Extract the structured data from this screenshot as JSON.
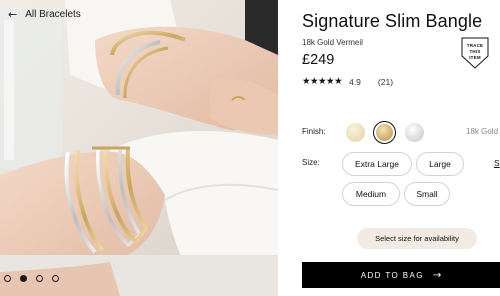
{
  "nav": {
    "back_label": "All Bracelets",
    "back_icon": "arrow-left-icon"
  },
  "gallery": {
    "slides": 4,
    "active_index": 1
  },
  "product": {
    "title": "Signature Slim Bangle",
    "subtitle": "18k Gold Vermeil",
    "price": "£249",
    "stars": "★★★★★",
    "rating": "4.9",
    "review_count": "(21)",
    "badge": [
      "TRACE",
      "THIS",
      "ITEM"
    ]
  },
  "finish": {
    "label": "Finish:",
    "selected_value": "18k Gold",
    "swatches": [
      {
        "name": "light-gold",
        "color": "#ead9b4",
        "selected": false
      },
      {
        "name": "gold",
        "color": "#d7b976",
        "selected": true
      },
      {
        "name": "silver",
        "color": "#e3e3e3",
        "selected": false
      }
    ]
  },
  "size": {
    "label": "Size:",
    "options": [
      "Extra Large",
      "Large",
      "Medium",
      "Small"
    ],
    "guide_label": "S"
  },
  "availability_label": "Select size for availability",
  "cta": {
    "label": "ADD TO BAG",
    "icon": "arrow-right-icon"
  },
  "colors": {
    "cta_bg": "#000000",
    "availability_bg": "#f1ebe3",
    "pill_border": "#d6d2cc"
  }
}
